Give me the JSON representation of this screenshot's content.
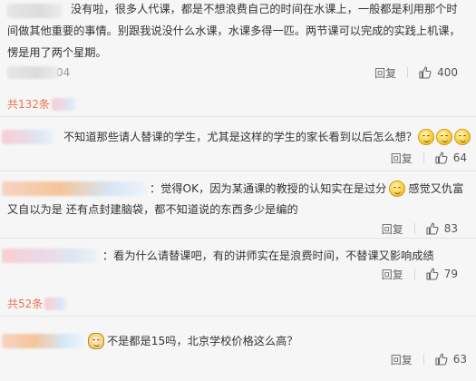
{
  "comments": [
    {
      "id": "c1",
      "text_lines": [
        "没有啦，很多人代课，都是不想浪费自己的时间在水课上，一般都是利用那个时",
        "间做其他重要的事情。别跟我说没什么水课，水课多得一匹。两节课可以完成的实践上机课，",
        "愣是用了两个星期。"
      ],
      "time": "04",
      "reply_label": "回复",
      "likes": "400"
    },
    {
      "id": "c2",
      "text": "不知道那些请人替课的学生，尤其是这样的学生的家长看到以后怎么想？",
      "reply_label": "回复",
      "likes": "64"
    },
    {
      "id": "c3",
      "text_line1_a": "：觉得OK，因为某通课的教授的认知实在是过分",
      "text_line1_b": "感觉又仇富",
      "text_line2": "又自以为是 还有点封建脑袋，都不知道说的东西多少是编的",
      "reply_label": "回复",
      "likes": "83"
    },
    {
      "id": "c4",
      "text": "：看为什么请替课吧，有的讲师实在是浪费时间，不替课又影响成绩",
      "reply_label": "回复",
      "likes": "79"
    },
    {
      "id": "c5",
      "text": "不是都是15吗，北京学校价格这么高？",
      "reply_label": "回复",
      "likes": "63"
    }
  ],
  "more_links": {
    "first": "共132条",
    "second": "共52条"
  },
  "colors": {
    "link": "#eb7350",
    "text": "#333333",
    "meta": "#666666"
  },
  "icons": {
    "like": "thumbs-up-icon",
    "emoji": "smiley-emoji-icon",
    "cat_emoji": "cat-emoji-icon"
  }
}
